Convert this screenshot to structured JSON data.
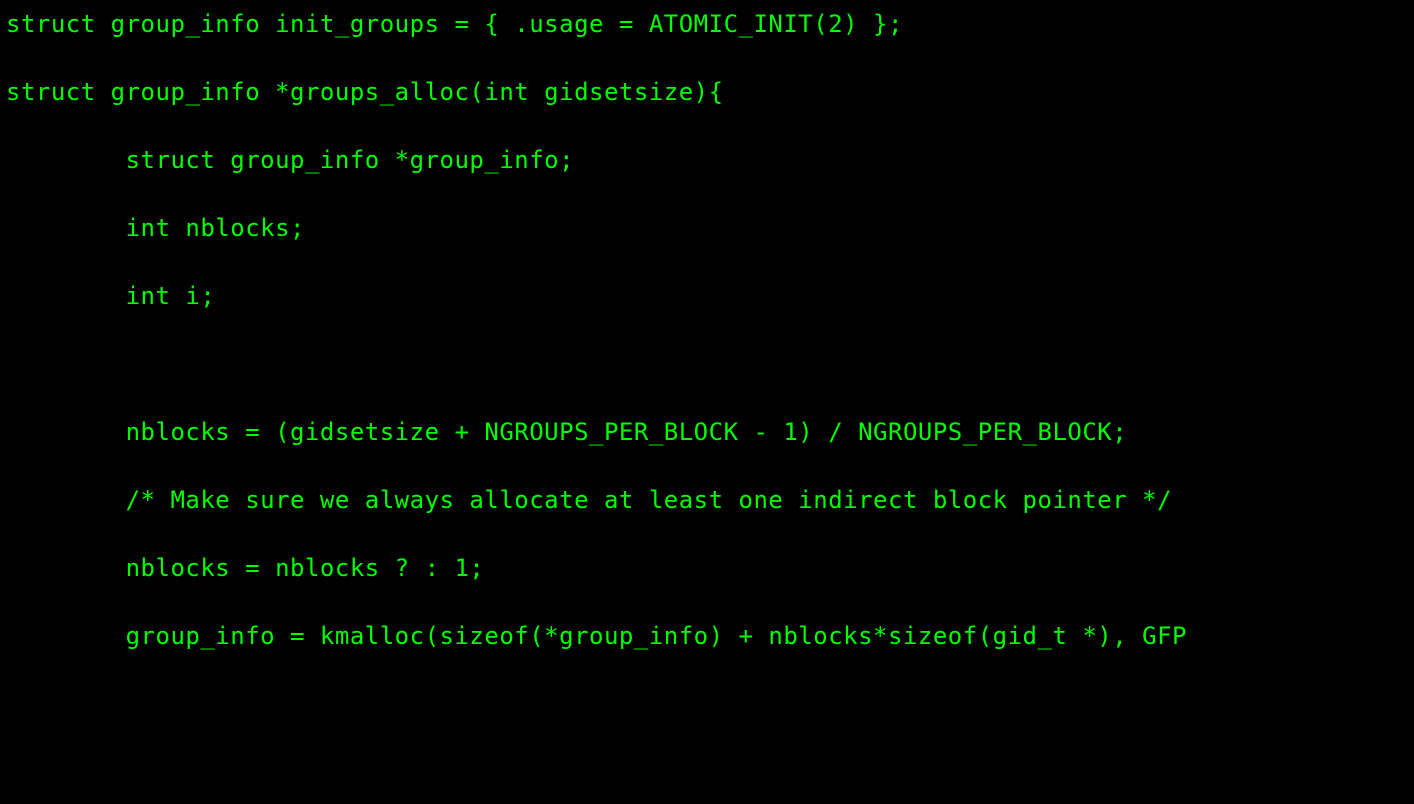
{
  "code": {
    "lines": [
      "struct group_info init_groups = { .usage = ATOMIC_INIT(2) };",
      "",
      "struct group_info *groups_alloc(int gidsetsize){",
      "",
      "        struct group_info *group_info;",
      "",
      "        int nblocks;",
      "",
      "        int i;",
      "",
      "",
      "",
      "        nblocks = (gidsetsize + NGROUPS_PER_BLOCK - 1) / NGROUPS_PER_BLOCK;",
      "",
      "        /* Make sure we always allocate at least one indirect block pointer */",
      "",
      "        nblocks = nblocks ? : 1;",
      "",
      "        group_info = kmalloc(sizeof(*group_info) + nblocks*sizeof(gid_t *), GFP"
    ]
  },
  "colors": {
    "background": "#000000",
    "text": "#00ff00"
  }
}
